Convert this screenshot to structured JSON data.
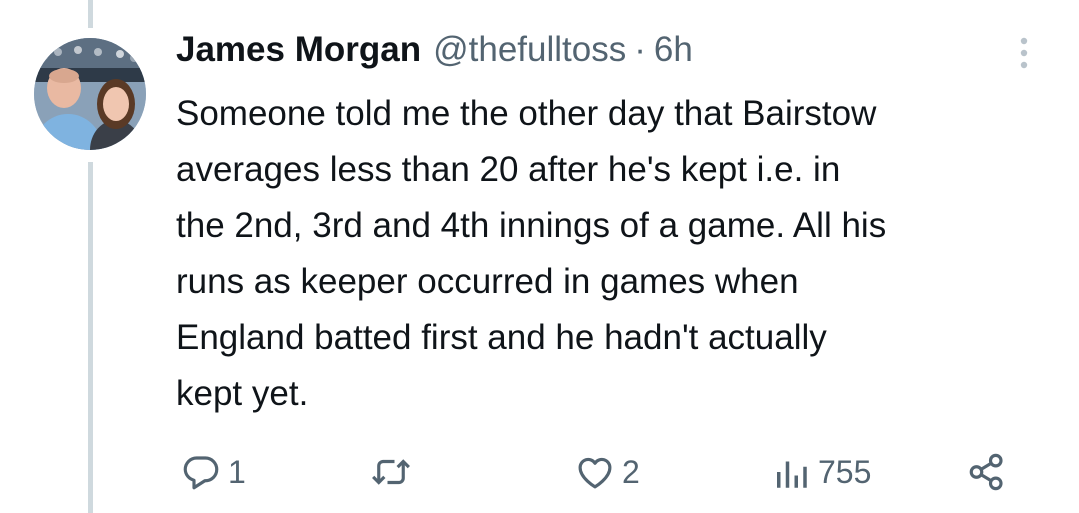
{
  "tweet": {
    "author_name": "James Morgan",
    "handle": "@thefulltoss",
    "separator": "·",
    "time": "6h",
    "text": "Someone told me the other day that Bairstow\naverages less than 20 after he's kept i.e. in\nthe 2nd, 3rd and 4th innings of a game. All his\nruns as keeper occurred in games when\nEngland batted first and he hadn't actually\nkept yet."
  },
  "actions": {
    "reply": {
      "icon": "reply-icon",
      "count": "1"
    },
    "retweet": {
      "icon": "retweet-icon",
      "count": ""
    },
    "like": {
      "icon": "heart-icon",
      "count": "2"
    },
    "views": {
      "icon": "views-icon",
      "count": "755"
    },
    "share": {
      "icon": "share-icon"
    }
  },
  "colors": {
    "text": "#0f1419",
    "secondary": "#536471",
    "thread_line": "#cfd9de"
  }
}
